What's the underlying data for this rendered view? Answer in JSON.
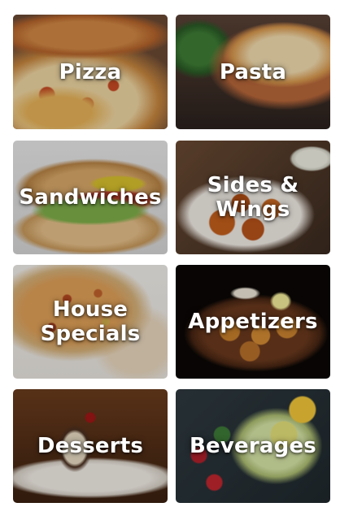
{
  "categories": [
    {
      "label": "Pizza",
      "image": "pizza-photo"
    },
    {
      "label": "Pasta",
      "image": "pasta-photo"
    },
    {
      "label": "Sandwiches",
      "image": "sandwich-photo"
    },
    {
      "label": "Sides &\nWings",
      "image": "wings-photo"
    },
    {
      "label": "House\nSpecials",
      "image": "house-special-pizza-photo"
    },
    {
      "label": "Appetizers",
      "image": "appetizers-photo"
    },
    {
      "label": "Desserts",
      "image": "dessert-photo"
    },
    {
      "label": "Beverages",
      "image": "beverages-photo"
    }
  ]
}
